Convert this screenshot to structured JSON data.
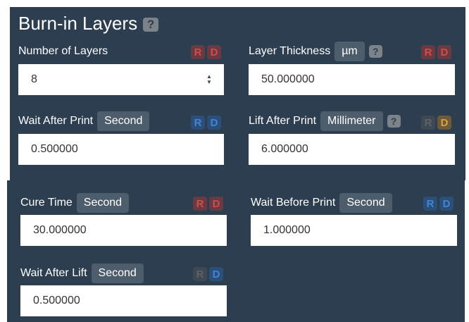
{
  "section": {
    "title": "Burn-in Layers",
    "help": "?"
  },
  "colors": {
    "panel_bg": "#2c3e50",
    "flag_red_bg": "#6a3a42",
    "flag_red_text": "#d14b4b",
    "flag_blue_bg": "#2c4f78",
    "flag_blue_text": "#3f84d8",
    "flag_gray_bg": "#3f4953",
    "flag_gray_text": "#5b636b",
    "flag_gold_bg": "#6d5a36",
    "flag_gold_text": "#d4a24a"
  },
  "fields": {
    "number_of_layers": {
      "label": "Number of Layers",
      "value": "8",
      "flags": [
        "R",
        "D"
      ],
      "spinner_icon": "up-down-arrows"
    },
    "layer_thickness": {
      "label": "Layer Thickness",
      "unit": "µm",
      "help": "?",
      "value": "50.000000",
      "flags": [
        "R",
        "D"
      ]
    },
    "wait_after_print": {
      "label": "Wait After Print",
      "unit": "Second",
      "value": "0.500000",
      "flags": [
        "R",
        "D"
      ]
    },
    "lift_after_print": {
      "label": "Lift After Print",
      "unit": "Millimeter",
      "help": "?",
      "value": "6.000000",
      "flags": [
        "R",
        "D"
      ]
    },
    "cure_time": {
      "label": "Cure Time",
      "unit": "Second",
      "value": "30.000000",
      "flags": [
        "R",
        "D"
      ]
    },
    "wait_before_print": {
      "label": "Wait Before Print",
      "unit": "Second",
      "value": "1.000000",
      "flags": [
        "R",
        "D"
      ]
    },
    "wait_after_lift": {
      "label": "Wait After Lift",
      "unit": "Second",
      "value": "0.500000",
      "flags": [
        "R",
        "D"
      ]
    }
  }
}
